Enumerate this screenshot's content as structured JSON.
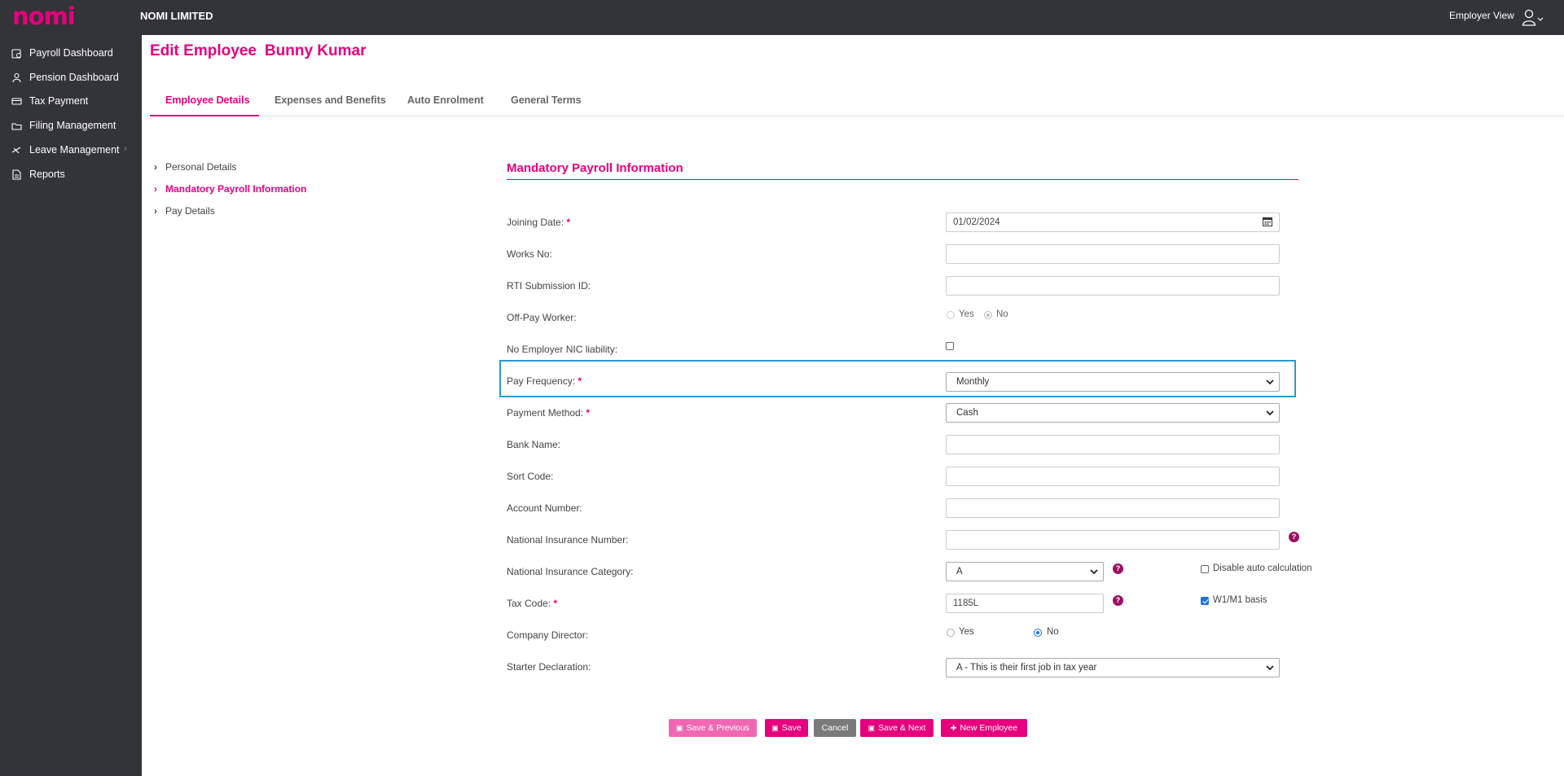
{
  "app": {
    "logo": "nomi",
    "company": "NOMI LIMITED",
    "employer_view": "Employer View"
  },
  "sidebar": {
    "items": [
      {
        "label": "Payroll Dashboard",
        "icon": "payroll-icon"
      },
      {
        "label": "Pension Dashboard",
        "icon": "pension-icon"
      },
      {
        "label": "Tax Payment",
        "icon": "tax-icon"
      },
      {
        "label": "Filing Management",
        "icon": "filing-icon"
      },
      {
        "label": "Leave Management",
        "icon": "leave-icon",
        "has_submenu": true
      },
      {
        "label": "Reports",
        "icon": "reports-icon"
      }
    ]
  },
  "page": {
    "title": "Edit Employee",
    "employee_name": "Bunny Kumar"
  },
  "tabs": [
    {
      "label": "Employee Details",
      "active": true
    },
    {
      "label": "Expenses and Benefits"
    },
    {
      "label": "Auto Enrolment"
    },
    {
      "label": "General Terms"
    }
  ],
  "leftnav": [
    {
      "label": "Personal Details"
    },
    {
      "label": "Mandatory Payroll Information",
      "active": true
    },
    {
      "label": "Pay Details"
    }
  ],
  "section": {
    "title": "Mandatory Payroll Information"
  },
  "fields": {
    "joining_date": {
      "label": "Joining Date:",
      "required": "*",
      "value": "01/02/2024"
    },
    "works_no": {
      "label": "Works No:",
      "value": ""
    },
    "rti_submission_id": {
      "label": "RTI Submission ID:",
      "value": ""
    },
    "off_pay_worker": {
      "label": "Off-Pay Worker:",
      "options": [
        "Yes",
        "No"
      ],
      "selected": "No"
    },
    "no_employer_nic": {
      "label": "No Employer NIC liability:",
      "checked": false
    },
    "pay_frequency": {
      "label": "Pay Frequency:",
      "required": "*",
      "value": "Monthly"
    },
    "payment_method": {
      "label": "Payment Method:",
      "required": "*",
      "value": "Cash"
    },
    "bank_name": {
      "label": "Bank Name:",
      "value": ""
    },
    "sort_code": {
      "label": "Sort Code:",
      "value": ""
    },
    "account_number": {
      "label": "Account Number:",
      "value": ""
    },
    "national_insurance_number": {
      "label": "National Insurance Number:",
      "value": ""
    },
    "national_insurance_category": {
      "label": "National Insurance Category:",
      "value": "A",
      "disable_auto_label": "Disable auto calculation",
      "disable_auto_checked": false
    },
    "tax_code": {
      "label": "Tax Code:",
      "required": "*",
      "value": "1185L",
      "w1m1_label": "W1/M1 basis",
      "w1m1_checked": true
    },
    "company_director": {
      "label": "Company Director:",
      "options": [
        "Yes",
        "No"
      ],
      "selected": "No"
    },
    "starter_declaration": {
      "label": "Starter Declaration:",
      "value": "A - This is their first job in tax year"
    }
  },
  "help_glyph": "?",
  "buttons": {
    "save_previous": "Save & Previous",
    "save": "Save",
    "cancel": "Cancel",
    "save_next": "Save & Next",
    "new_employee": "New Employee"
  },
  "colors": {
    "brand": "#e6007e",
    "sidebar": "#333437",
    "focus": "#2b9ad1",
    "help": "#9b1063"
  }
}
